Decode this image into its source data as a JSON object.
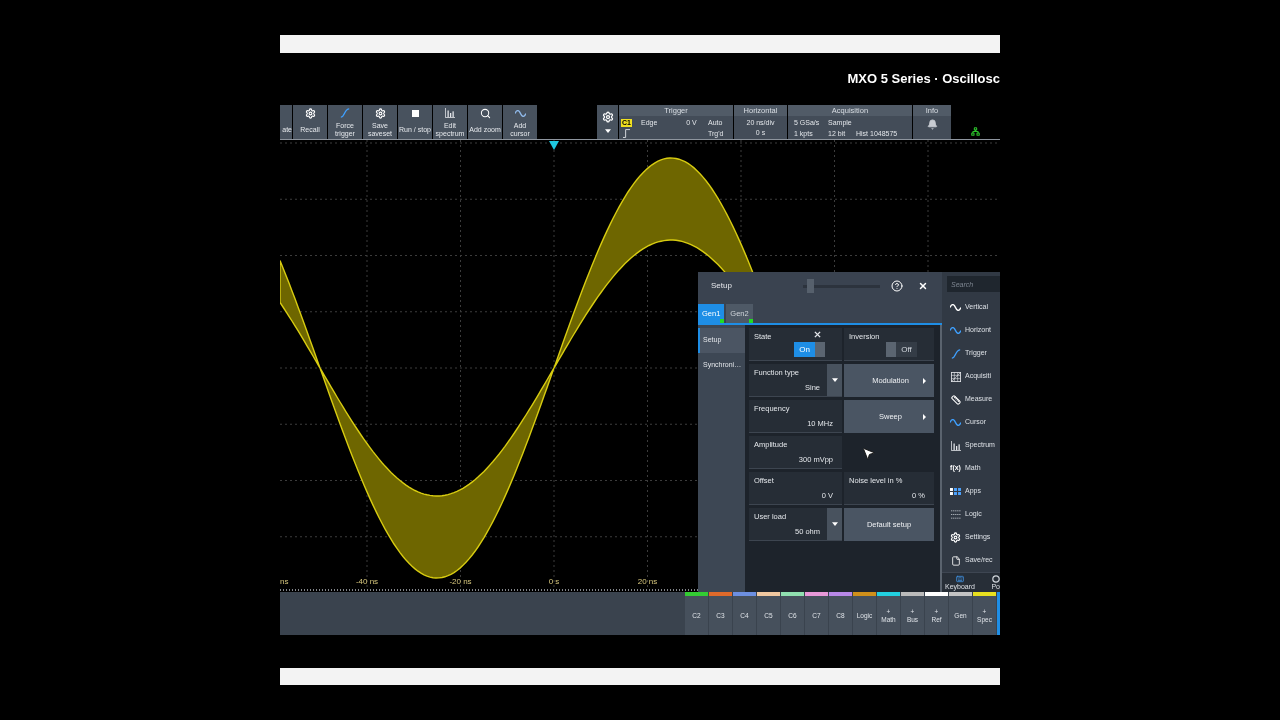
{
  "header": {
    "title": "MXO 5 Series · Oscillosc"
  },
  "toolbar": {
    "buttons": [
      {
        "lines": [
          "ate"
        ]
      },
      {
        "lines": [
          "Recall"
        ]
      },
      {
        "lines": [
          "Force",
          "trigger"
        ]
      },
      {
        "lines": [
          "Save",
          "saveset"
        ]
      },
      {
        "lines": [
          "Run / stop"
        ]
      },
      {
        "lines": [
          "Edit",
          "spectrum"
        ]
      },
      {
        "lines": [
          "Add zoom"
        ]
      },
      {
        "lines": [
          "Add",
          "cursor"
        ]
      }
    ]
  },
  "status_panels": {
    "trigger": {
      "title": "Trigger",
      "source": "C1",
      "type": "Edge",
      "threshold": "0 V",
      "mode": "Auto",
      "state": "Trg'd"
    },
    "horizontal": {
      "title": "Horizontal",
      "scale": "20 ns/div",
      "position": "0 s"
    },
    "acquisition": {
      "title": "Acquisition",
      "sample_rate": "5 GSa/s",
      "mode": "Sample",
      "record_length": "1 kpts",
      "resolution": "12 bit",
      "history": "Hist 1048575"
    },
    "info": {
      "title": "Info"
    }
  },
  "plot": {
    "x_labels": [
      "ns",
      "-40 ns",
      "-20 ns",
      "0 s",
      "20 ns"
    ]
  },
  "setup_dialog": {
    "title": "Setup",
    "transparency": {
      "level": 0.05
    },
    "tabs": [
      {
        "label": "Gen1",
        "selected": true
      },
      {
        "label": "Gen2",
        "selected": false
      }
    ],
    "nav": [
      {
        "label": "Setup",
        "selected": true
      },
      {
        "label": "Synchroni…",
        "selected": false
      }
    ],
    "rows": [
      [
        {
          "kind": "toggle",
          "label": "State",
          "on": true,
          "text": "On"
        },
        {
          "kind": "toggle",
          "label": "Inversion",
          "on": false,
          "text": "Off"
        }
      ],
      [
        {
          "kind": "dropdown",
          "label": "Function type",
          "value": "Sine"
        },
        {
          "kind": "submenu",
          "label": "Modulation"
        }
      ],
      [
        {
          "kind": "value",
          "label": "Frequency",
          "value": "10 MHz"
        },
        {
          "kind": "submenu",
          "label": "Sweep"
        }
      ],
      [
        {
          "kind": "value",
          "label": "Amplitude",
          "value": "300 mVpp"
        }
      ],
      [
        {
          "kind": "value",
          "label": "Offset",
          "value": "0 V"
        },
        {
          "kind": "value",
          "label": "Noise level in %",
          "value": "0 %"
        }
      ],
      [
        {
          "kind": "dropdown",
          "label": "User load",
          "value": "50 ohm"
        },
        {
          "kind": "button",
          "label": "Default setup"
        }
      ]
    ]
  },
  "side_menu": {
    "search": {
      "placeholder": "Search"
    },
    "items": [
      {
        "label": "Vertical"
      },
      {
        "label": "Horizont"
      },
      {
        "label": "Trigger"
      },
      {
        "label": "Acquisiti"
      },
      {
        "label": "Measure"
      },
      {
        "label": "Cursor"
      },
      {
        "label": "Spectrum"
      },
      {
        "label": "Math",
        "glyph": "f(x)"
      },
      {
        "label": "Apps"
      },
      {
        "label": "Logic"
      },
      {
        "label": "Settings"
      },
      {
        "label": "Save/rec"
      }
    ],
    "footer": [
      {
        "label": "Keyboard"
      },
      {
        "label": "Po"
      }
    ]
  },
  "channel_bar": [
    {
      "label": "C2",
      "color": "#33cc33"
    },
    {
      "label": "C3",
      "color": "#e06a2a"
    },
    {
      "label": "C4",
      "color": "#6d8fe0"
    },
    {
      "label": "C5",
      "color": "#f0c8a0"
    },
    {
      "label": "C6",
      "color": "#90e0b0"
    },
    {
      "label": "C7",
      "color": "#e898d8"
    },
    {
      "label": "C8",
      "color": "#b888e8"
    },
    {
      "label": "Logic",
      "color": "#d0901a"
    },
    {
      "label": "Math",
      "prefix": "+",
      "color": "#22d0e0"
    },
    {
      "label": "Bus",
      "prefix": "+",
      "color": "#bbbbbb"
    },
    {
      "label": "Ref",
      "prefix": "+",
      "color": "#ffffff"
    },
    {
      "label": "Gen",
      "color": "#c4c4c4"
    },
    {
      "label": "Spec",
      "prefix": "+",
      "color": "#e8e020"
    }
  ]
}
